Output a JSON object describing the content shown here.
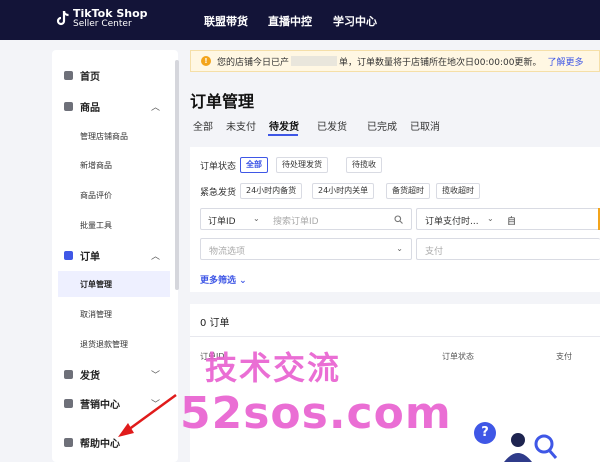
{
  "header": {
    "logo_title": "TikTok Shop",
    "logo_subtitle": "Seller Center",
    "nav": [
      "联盟带货",
      "直播中控",
      "学习中心"
    ]
  },
  "sidebar": {
    "home": "首页",
    "products": {
      "label": "商品",
      "items": [
        "管理店铺商品",
        "新增商品",
        "商品评价",
        "批量工具"
      ]
    },
    "orders": {
      "label": "订单",
      "items": [
        "订单管理",
        "取消管理",
        "退货退款管理"
      ]
    },
    "shipping": "发货",
    "marketing": "营销中心",
    "help": "帮助中心"
  },
  "notice": {
    "text": "您的店铺今日已产",
    "text2": "单，订单数量将于店铺所在地次日00:00:00更新。",
    "link": "了解更多"
  },
  "page_title": "订单管理",
  "tabs": [
    "全部",
    "未支付",
    "待发货",
    "已发货",
    "已完成",
    "已取消"
  ],
  "active_tab": "待发货",
  "filters": {
    "status_label": "订单状态",
    "status_chips": [
      "全部",
      "待处理发货",
      "待揽收"
    ],
    "urgent_label": "紧急发货",
    "urgent_chips": [
      "24小时内备货",
      "24小时内关单",
      "备货超时",
      "揽收超时"
    ],
    "order_id_select": "订单ID",
    "order_id_placeholder": "搜索订单ID",
    "pay_time_select": "订单支付时...",
    "pay_time_from": "自",
    "logistics_placeholder": "物流选项",
    "payment_placeholder": "支付",
    "more_filters": "更多筛选"
  },
  "results": {
    "count": "0 订单",
    "columns": [
      "订单ID",
      "订单状态",
      "支付"
    ]
  },
  "watermark": {
    "line1": "技术交流",
    "line2": "52sos.com"
  },
  "colors": {
    "topbar": "#131438",
    "accent": "#3f57e6",
    "watermark": "#e85fd0",
    "arrow": "#e01b1b"
  }
}
